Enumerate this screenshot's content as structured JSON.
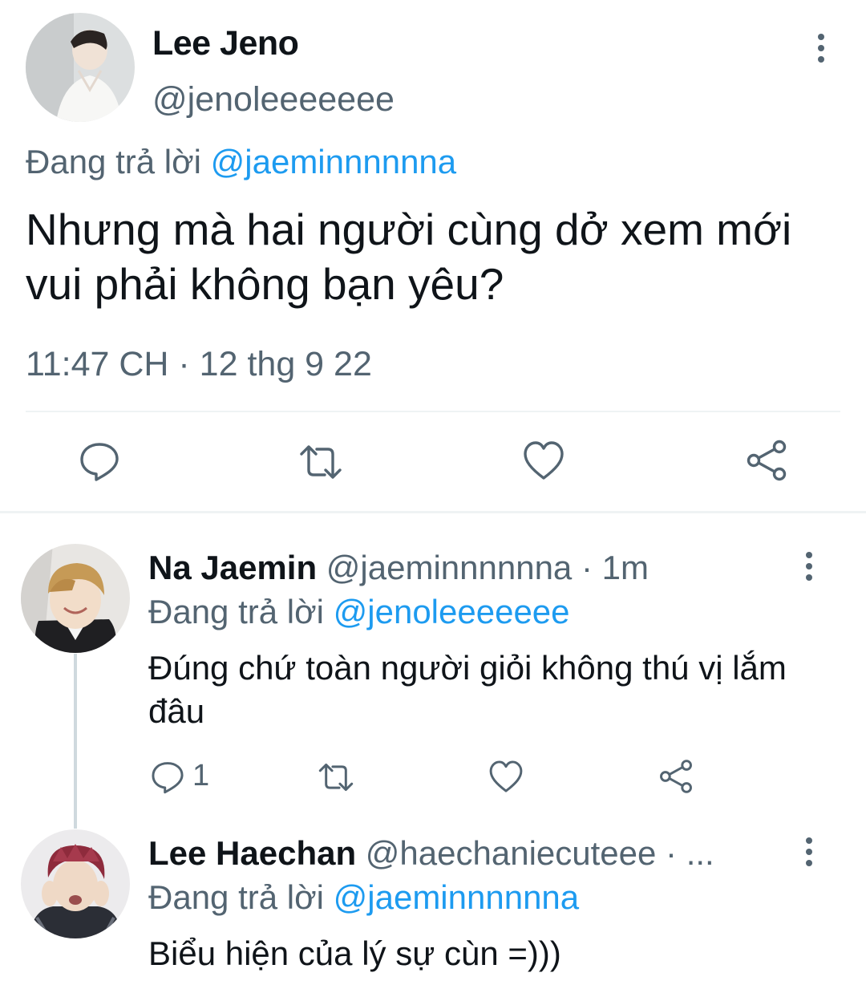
{
  "main_tweet": {
    "author_name": "Lee Jeno",
    "author_handle": "@jenoleeeeeee",
    "replying_prefix": "Đang trả lời",
    "replying_to": "@jaeminnnnnna",
    "text": "Nhưng mà hai người cùng dở xem mới vui phải không bạn yêu?",
    "timestamp": "11:47 CH · 12 thg 9 22",
    "actions": [
      "reply-icon",
      "retweet-icon",
      "like-icon",
      "share-icon"
    ]
  },
  "replies": [
    {
      "author_name": "Na Jaemin",
      "author_handle": "@jaeminnnnnna",
      "time": "· 1m",
      "replying_prefix": "Đang trả lời",
      "replying_to": "@jenoleeeeeee",
      "text": "Đúng chứ toàn người giỏi không thú vị lắm đâu",
      "reply_count": "1"
    },
    {
      "author_name": "Lee Haechan",
      "author_handle": "@haechaniecuteee",
      "time": "· ...",
      "replying_prefix": "Đang trả lời",
      "replying_to": "@jaeminnnnnna",
      "text": "Biểu hiện của lý sự cùn =)))"
    }
  ],
  "colors": {
    "text": "#0f1419",
    "secondary": "#536471",
    "link": "#1d9bf0",
    "divider": "#eff3f4"
  }
}
